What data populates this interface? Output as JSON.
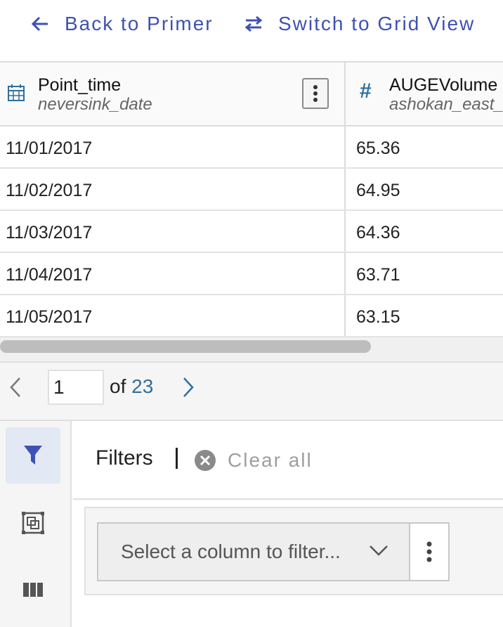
{
  "nav": {
    "back_label": "Back to Primer",
    "switch_label": "Switch to Grid View"
  },
  "table": {
    "columns": [
      {
        "name": "Point_time",
        "source": "neversink_date",
        "type_icon": "calendar-icon"
      },
      {
        "name": "AUGEVolume",
        "source": "ashokan_east_",
        "type_icon": "number-hash-icon",
        "type_glyph": "#"
      }
    ],
    "rows": [
      [
        "11/01/2017",
        "65.36"
      ],
      [
        "11/02/2017",
        "64.95"
      ],
      [
        "11/03/2017",
        "64.36"
      ],
      [
        "11/04/2017",
        "63.71"
      ],
      [
        "11/05/2017",
        "63.15"
      ]
    ]
  },
  "pagination": {
    "current_page": "1",
    "of_label": "of",
    "total_pages": "23"
  },
  "filters": {
    "title": "Filters",
    "clear_all_label": "Clear all",
    "select_placeholder": "Select a column to filter..."
  },
  "colors": {
    "accent": "#3f51b5",
    "link_blue": "#2f6fa0"
  }
}
